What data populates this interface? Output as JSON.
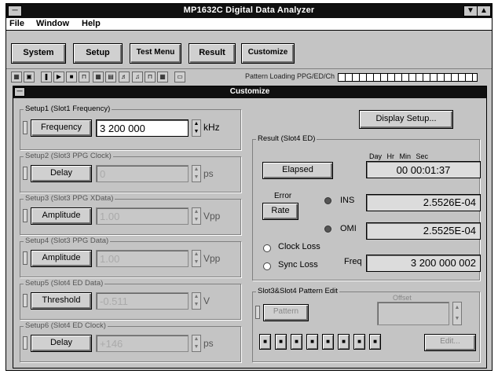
{
  "window": {
    "title": "MP1632C Digital Data Analyzer"
  },
  "menu": [
    "File",
    "Window",
    "Help"
  ],
  "tabs": [
    "System",
    "Setup",
    "Test Menu",
    "Result",
    "Customize"
  ],
  "toolbar": {
    "status_label": "Pattern Loading PPG/ED/Ch"
  },
  "customize": {
    "title": "Customize",
    "display_setup_label": "Display Setup...",
    "setups": [
      {
        "label": "Setup1 (Slot1 Frequency)",
        "button": "Frequency",
        "value": "3 200 000",
        "unit": "kHz",
        "active": true
      },
      {
        "label": "Setup2 (Slot3 PPG Clock)",
        "button": "Delay",
        "value": "0",
        "unit": "ps",
        "active": false
      },
      {
        "label": "Setup3 (Slot3 PPG XData)",
        "button": "Amplitude",
        "value": "1.00",
        "unit": "Vpp",
        "active": false
      },
      {
        "label": "Setup4 (Slot3 PPG Data)",
        "button": "Amplitude",
        "value": "1.00",
        "unit": "Vpp",
        "active": false
      },
      {
        "label": "Setup5 (Slot4 ED Data)",
        "button": "Threshold",
        "value": "-0.511",
        "unit": "V",
        "active": false
      },
      {
        "label": "Setup6 (Slot4 ED Clock)",
        "button": "Delay",
        "value": "+146",
        "unit": "ps",
        "active": false
      }
    ],
    "result": {
      "label": "Result (Slot4 ED)",
      "elapsed_button": "Elapsed",
      "time_header": "Day   Hr Min Sec",
      "time_value": "00 00:01:37",
      "error_label": "Error",
      "rate_button": "Rate",
      "ins_label": "INS",
      "ins_value": "2.5526E-04",
      "omi_label": "OMI",
      "omi_value": "2.5525E-04",
      "clock_loss_label": "Clock Loss",
      "sync_loss_label": "Sync Loss",
      "freq_label": "Freq",
      "freq_value": "3 200 000 002"
    },
    "pattern": {
      "label": "Slot3&Slot4 Pattern Edit",
      "pattern_button": "Pattern",
      "offset_label": "Offset",
      "edit_button": "Edit...",
      "bits": [
        "",
        "",
        "",
        "",
        "",
        "",
        "",
        ""
      ]
    }
  }
}
